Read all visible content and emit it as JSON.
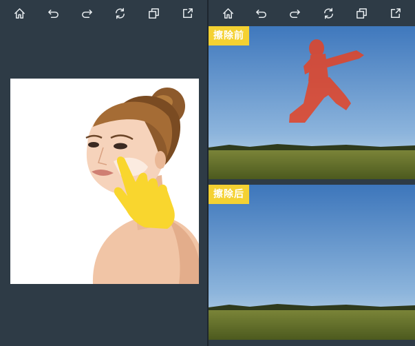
{
  "left_toolbar": {
    "icons": [
      "home-icon",
      "undo-icon",
      "redo-icon",
      "reset-icon",
      "compare-icon",
      "share-icon"
    ]
  },
  "right_toolbar": {
    "icons": [
      "home-icon",
      "undo-icon",
      "redo-icon",
      "reset-icon",
      "compare-icon",
      "share-icon"
    ]
  },
  "before_label": "擦除前",
  "after_label": "擦除后",
  "colors": {
    "background": "#2e3b46",
    "label_bg": "#f4d132",
    "hand_yellow": "#f9d62e",
    "erase_highlight": "#e0452a"
  }
}
